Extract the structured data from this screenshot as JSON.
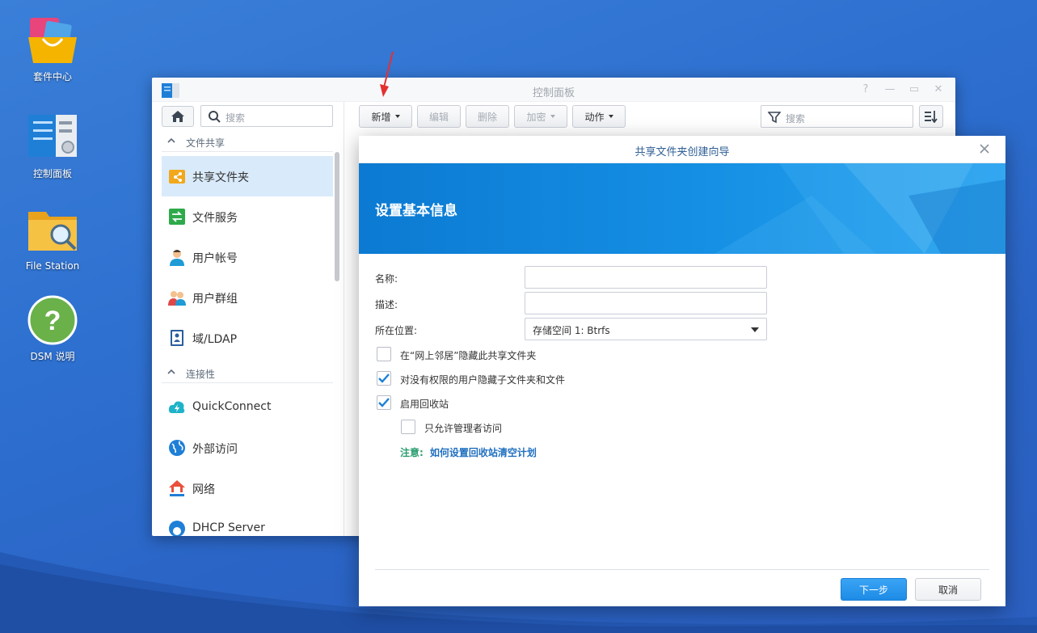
{
  "desktop": {
    "icons": [
      {
        "label": "套件中心",
        "icon": "package-center-icon"
      },
      {
        "label": "控制面板",
        "icon": "control-panel-icon"
      },
      {
        "label": "File Station",
        "icon": "file-station-icon"
      },
      {
        "label": "DSM 说明",
        "icon": "help-icon"
      }
    ]
  },
  "control_panel": {
    "title": "控制面板",
    "search_placeholder": "搜索",
    "sections": {
      "file_sharing": "文件共享",
      "connectivity": "连接性"
    },
    "sidebar_items": [
      {
        "label": "共享文件夹",
        "icon": "shared-folder-icon",
        "active": true
      },
      {
        "label": "文件服务",
        "icon": "file-services-icon"
      },
      {
        "label": "用户帐号",
        "icon": "user-icon"
      },
      {
        "label": "用户群组",
        "icon": "group-icon"
      },
      {
        "label": "域/LDAP",
        "icon": "domain-ldap-icon"
      },
      {
        "label": "QuickConnect",
        "icon": "quickconnect-icon"
      },
      {
        "label": "外部访问",
        "icon": "external-access-icon"
      },
      {
        "label": "网络",
        "icon": "network-icon"
      },
      {
        "label": "DHCP Server",
        "icon": "dhcp-server-icon"
      }
    ],
    "toolbar": {
      "create": "新增",
      "edit": "编辑",
      "delete": "删除",
      "encrypt": "加密",
      "action": "动作",
      "search_placeholder": "搜索"
    }
  },
  "wizard": {
    "title": "共享文件夹创建向导",
    "banner_title": "设置基本信息",
    "fields": {
      "name_label": "名称:",
      "name_value": "",
      "description_label": "描述:",
      "description_value": "",
      "location_label": "所在位置:",
      "location_value": "存储空间 1:  Btrfs"
    },
    "options": [
      {
        "label": "在“网上邻居”隐藏此共享文件夹",
        "checked": false
      },
      {
        "label": "对没有权限的用户隐藏子文件夹和文件",
        "checked": true
      },
      {
        "label": "启用回收站",
        "checked": true
      },
      {
        "label": "只允许管理者访问",
        "checked": false
      }
    ],
    "note_key": "注意:",
    "note_link": "如何设置回收站清空计划",
    "next_button": "下一步",
    "cancel_button": "取消"
  },
  "colors": {
    "accent": "#1d8be6",
    "banner": "#1590e4",
    "note_green": "#2a9d6f",
    "link_blue": "#1f6fc0",
    "annotation_arrow": "#e53030"
  }
}
